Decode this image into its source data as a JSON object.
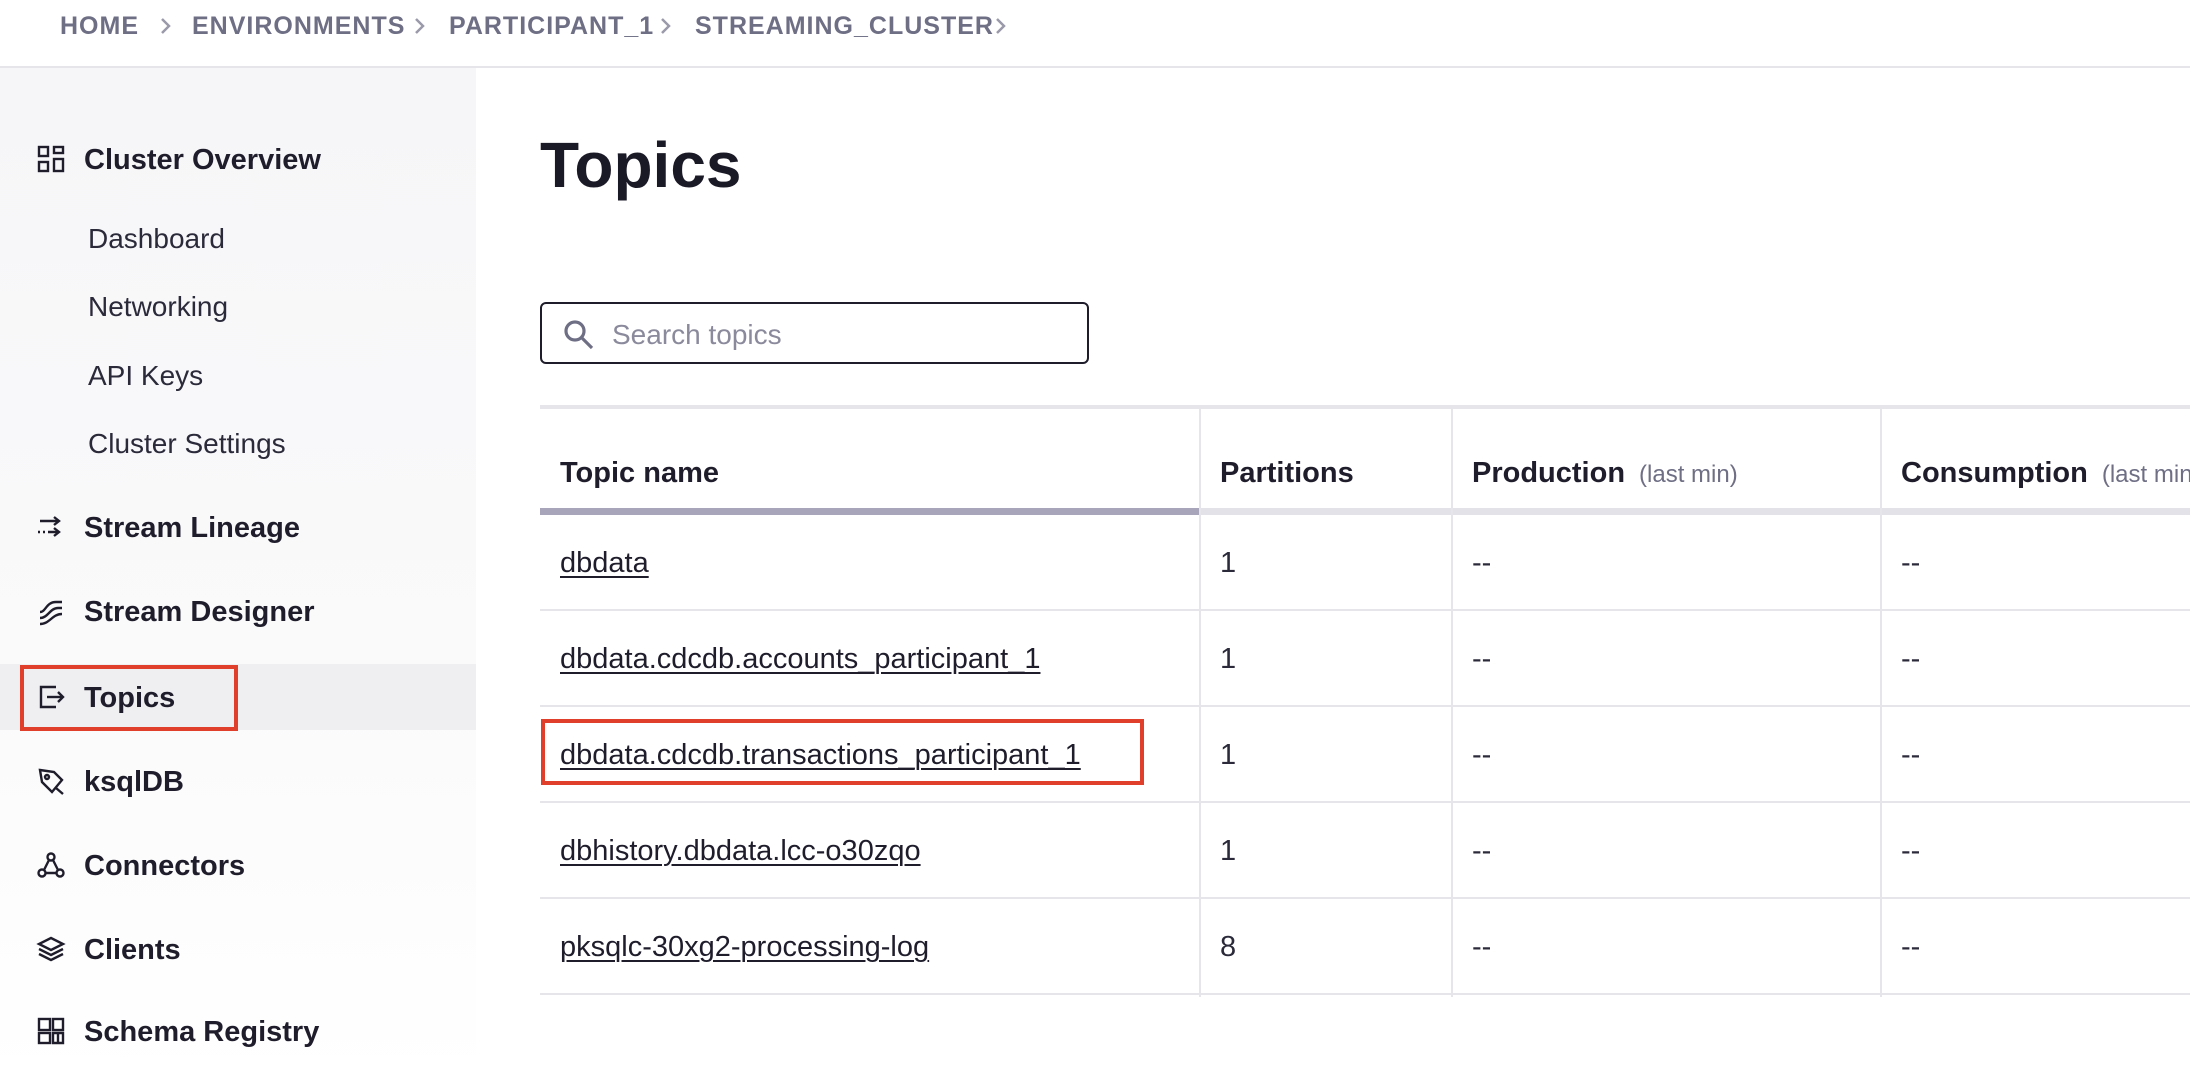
{
  "breadcrumb": {
    "items": [
      "HOME",
      "ENVIRONMENTS",
      "PARTICIPANT_1",
      "STREAMING_CLUSTER"
    ]
  },
  "sidebar": {
    "cluster_overview": {
      "label": "Cluster Overview",
      "icon": "grid-icon"
    },
    "sub_items": [
      "Dashboard",
      "Networking",
      "API Keys",
      "Cluster Settings"
    ],
    "items": [
      {
        "label": "Stream Lineage",
        "icon": "stream-lineage-icon"
      },
      {
        "label": "Stream Designer",
        "icon": "stream-designer-icon"
      },
      {
        "label": "Topics",
        "icon": "topics-icon",
        "active": true
      },
      {
        "label": "ksqlDB",
        "icon": "ksqldb-icon"
      },
      {
        "label": "Connectors",
        "icon": "connectors-icon"
      },
      {
        "label": "Clients",
        "icon": "clients-icon"
      },
      {
        "label": "Schema Registry",
        "icon": "schema-registry-icon"
      }
    ]
  },
  "main": {
    "title": "Topics",
    "search": {
      "placeholder": "Search topics",
      "value": ""
    }
  },
  "table": {
    "columns": [
      {
        "label": "Topic name",
        "sub": ""
      },
      {
        "label": "Partitions",
        "sub": ""
      },
      {
        "label": "Production",
        "sub": "(last min)"
      },
      {
        "label": "Consumption",
        "sub": "(last min)"
      }
    ],
    "rows": [
      {
        "name": "dbdata",
        "partitions": "1",
        "production": "--",
        "consumption": "--"
      },
      {
        "name": "dbdata.cdcdb.accounts_participant_1",
        "partitions": "1",
        "production": "--",
        "consumption": "--"
      },
      {
        "name": "dbdata.cdcdb.transactions_participant_1",
        "partitions": "1",
        "production": "--",
        "consumption": "--"
      },
      {
        "name": "dbhistory.dbdata.lcc-o30zqo",
        "partitions": "1",
        "production": "--",
        "consumption": "--"
      },
      {
        "name": "pksqlc-30xg2-processing-log",
        "partitions": "8",
        "production": "--",
        "consumption": "--"
      }
    ]
  },
  "colors": {
    "highlight": "#e0402b",
    "text": "#1f1d2b",
    "muted": "#6e6e85"
  }
}
